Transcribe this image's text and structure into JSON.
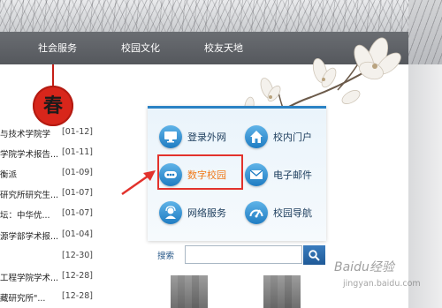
{
  "nav": {
    "items": [
      "社会服务",
      "校园文化",
      "校友天地"
    ]
  },
  "emblem": {
    "text": "春"
  },
  "news": [
    {
      "title": "与技术学院学",
      "date": "[01-12]"
    },
    {
      "title": "学院学术报告...",
      "date": "[01-11]"
    },
    {
      "title": "衡派",
      "date": "[01-09]"
    },
    {
      "title": "研究所研究生...",
      "date": "[01-07]"
    },
    {
      "title": "坛：中华优...",
      "date": "[01-07]"
    },
    {
      "title": "源学部学术报...",
      "date": "[01-04]"
    },
    {
      "title": "",
      "date": "[12-30]"
    },
    {
      "title": "工程学院学术...",
      "date": "[12-28]"
    },
    {
      "title": "藏研究所\"...",
      "date": "[12-28]"
    }
  ],
  "services": {
    "items": [
      {
        "label": "登录外网",
        "icon": "monitor-icon"
      },
      {
        "label": "校内门户",
        "icon": "home-icon"
      },
      {
        "label": "数字校园",
        "icon": "dots-icon"
      },
      {
        "label": "电子邮件",
        "icon": "mail-icon"
      },
      {
        "label": "网络服务",
        "icon": "user-support-icon"
      },
      {
        "label": "校园导航",
        "icon": "gauge-icon"
      }
    ]
  },
  "search": {
    "label": "搜索",
    "value": ""
  },
  "watermark": {
    "text": "Baidu经验",
    "url": "jingyan.baidu.com"
  },
  "colors": {
    "nav_bg": "#5f6267",
    "panel_accent": "#2a82c4",
    "highlight": "#e2322c",
    "highlight_text": "#f07a1a",
    "emblem": "#d8261b"
  }
}
